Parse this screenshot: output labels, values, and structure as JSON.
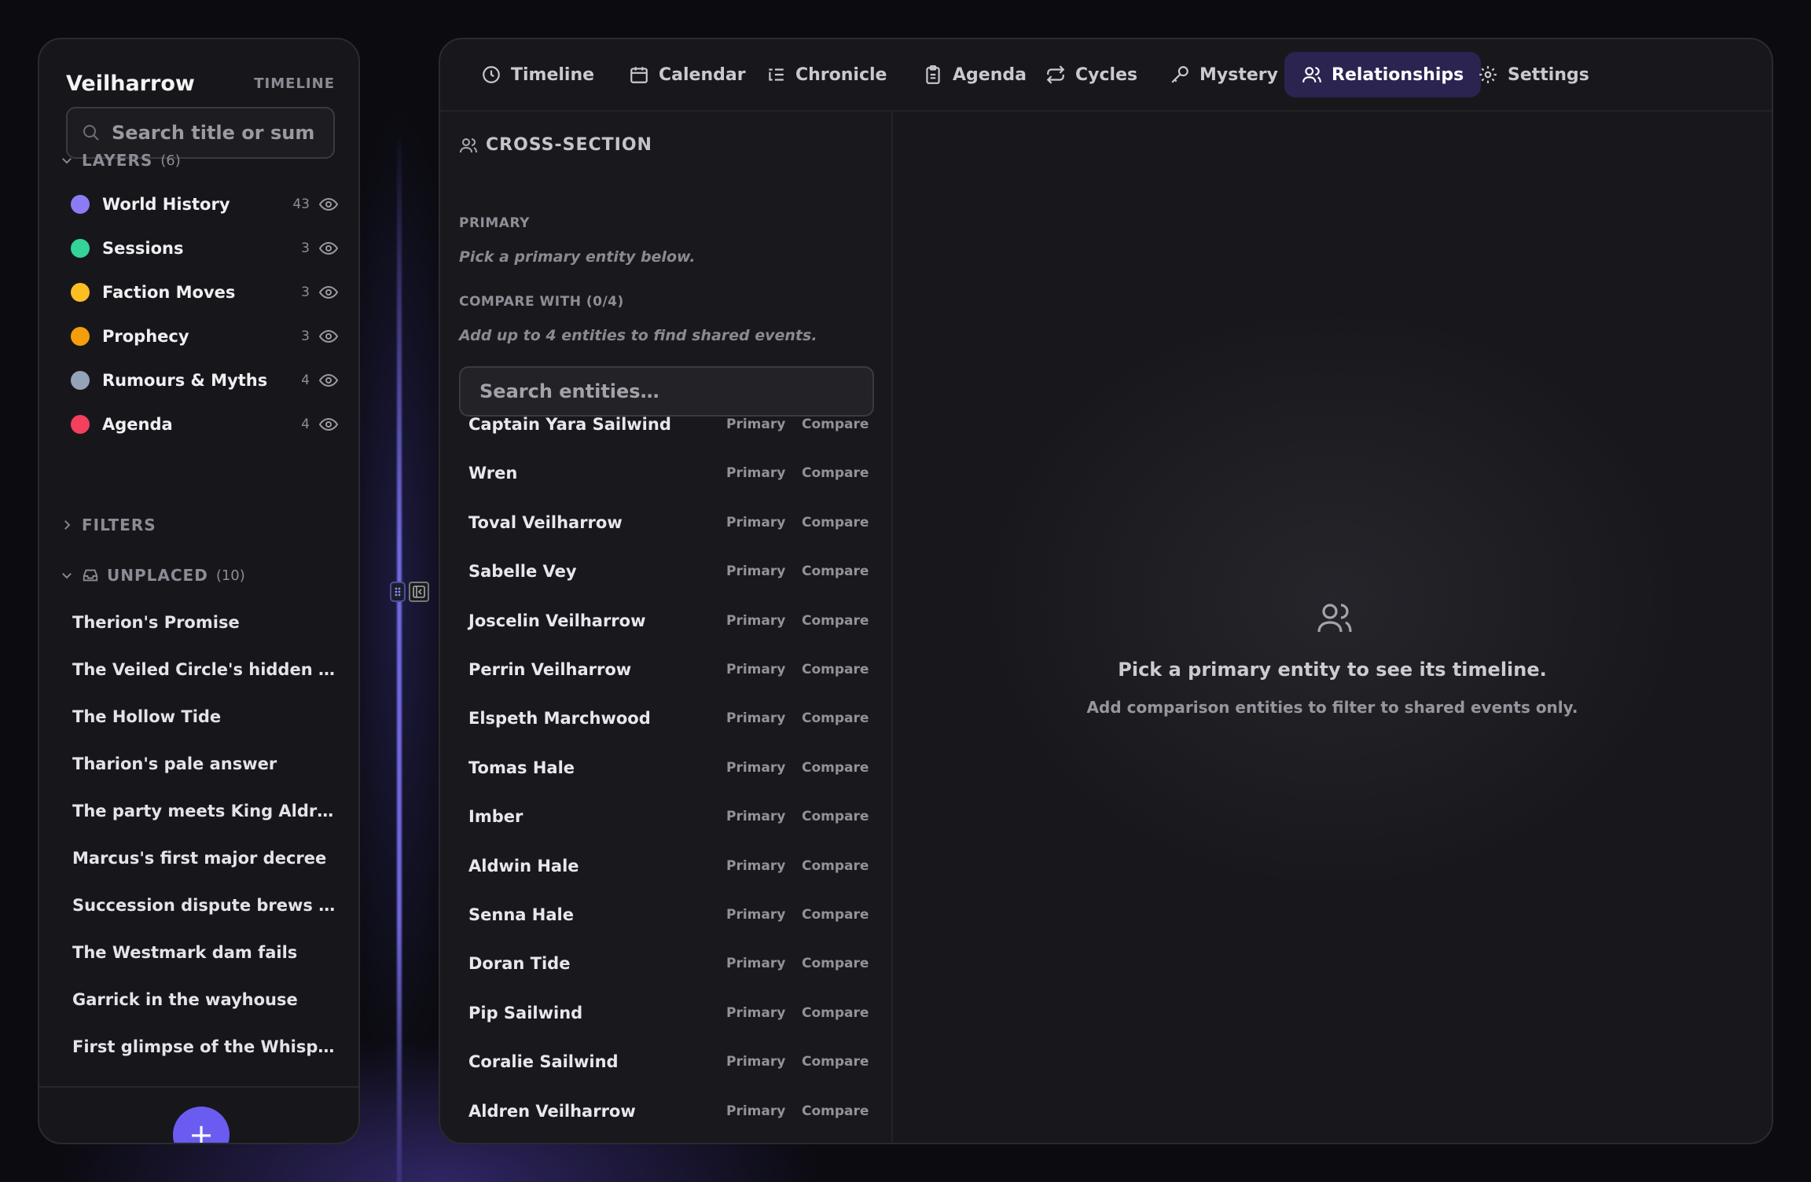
{
  "sidebar": {
    "brand": "Veilharrow",
    "brand_sub": "TIMELINE",
    "search_placeholder": "Search title or summary",
    "layers_label": "LAYERS",
    "layers_count": "(6)",
    "layers": [
      {
        "name": "World History",
        "count": "43",
        "color": "#8b7cf6"
      },
      {
        "name": "Sessions",
        "count": "3",
        "color": "#34d399"
      },
      {
        "name": "Faction Moves",
        "count": "3",
        "color": "#fbbf24"
      },
      {
        "name": "Prophecy",
        "count": "3",
        "color": "#f59e0b"
      },
      {
        "name": "Rumours & Myths",
        "count": "4",
        "color": "#94a3b8"
      },
      {
        "name": "Agenda",
        "count": "4",
        "color": "#f43f5e"
      }
    ],
    "filters_label": "FILTERS",
    "unplaced_label": "UNPLACED",
    "unplaced_count": "(10)",
    "unplaced": [
      "Therion's Promise",
      "The Veiled Circle's hidden arch…",
      "The Hollow Tide",
      "Tharion's pale answer",
      "The party meets King Aldren",
      "Marcus's first major decree",
      "Succession dispute brews in th…",
      "The Westmark dam fails",
      "Garrick in the wayhouse",
      "First glimpse of the Whispered…"
    ],
    "fab_label": "+"
  },
  "tabs": [
    {
      "label": "Timeline",
      "icon": "clock-icon"
    },
    {
      "label": "Calendar",
      "icon": "calendar-icon"
    },
    {
      "label": "Chronicle",
      "icon": "list-icon"
    },
    {
      "label": "Agenda",
      "icon": "clipboard-icon"
    },
    {
      "label": "Cycles",
      "icon": "repeat-icon"
    },
    {
      "label": "Mystery",
      "icon": "key-icon"
    },
    {
      "label": "Relationships",
      "icon": "users-icon",
      "active": true
    },
    {
      "label": "Settings",
      "icon": "gear-icon"
    }
  ],
  "cross_section": {
    "title": "CROSS-SECTION",
    "primary_label": "PRIMARY",
    "primary_hint": "Pick a primary entity below.",
    "compare_label": "COMPARE WITH (0/4)",
    "compare_hint": "Add up to 4 entities to find shared events.",
    "search_placeholder": "Search entities…",
    "primary_btn": "Primary",
    "compare_btn": "Compare",
    "entities": [
      "Captain Yara Sailwind",
      "Wren",
      "Toval Veilharrow",
      "Sabelle Vey",
      "Joscelin Veilharrow",
      "Perrin Veilharrow",
      "Elspeth Marchwood",
      "Tomas Hale",
      "Imber",
      "Aldwin Hale",
      "Senna Hale",
      "Doran Tide",
      "Pip Sailwind",
      "Coralie Sailwind",
      "Aldren Veilharrow"
    ]
  },
  "empty_state": {
    "title": "Pick a primary entity to see its timeline.",
    "subtitle": "Add comparison entities to filter to shared events only."
  }
}
